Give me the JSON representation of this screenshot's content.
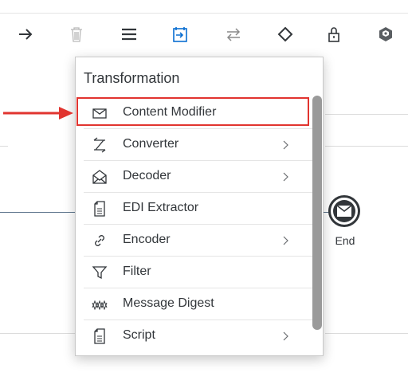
{
  "toolbar": {
    "items": [
      {
        "icon": "arrow-right-icon"
      },
      {
        "icon": "trash-icon"
      },
      {
        "icon": "menu-lines-icon"
      },
      {
        "icon": "transformation-icon"
      },
      {
        "icon": "exchange-icon"
      },
      {
        "icon": "diamond-icon"
      },
      {
        "icon": "lock-icon"
      },
      {
        "icon": "cube-icon"
      }
    ]
  },
  "canvas": {
    "end_event_label": "End"
  },
  "menu": {
    "title": "Transformation",
    "items": [
      {
        "label": "Content Modifier",
        "icon": "envelope-icon",
        "has_submenu": false,
        "highlighted": true
      },
      {
        "label": "Converter",
        "icon": "converter-icon",
        "has_submenu": true
      },
      {
        "label": "Decoder",
        "icon": "open-envelope-icon",
        "has_submenu": true
      },
      {
        "label": "EDI Extractor",
        "icon": "document-icon",
        "has_submenu": false
      },
      {
        "label": "Encoder",
        "icon": "link-icon",
        "has_submenu": true
      },
      {
        "label": "Filter",
        "icon": "filter-icon",
        "has_submenu": false
      },
      {
        "label": "Message Digest",
        "icon": "zigzag-icon",
        "has_submenu": false
      },
      {
        "label": "Script",
        "icon": "script-document-icon",
        "has_submenu": true
      }
    ]
  },
  "colors": {
    "highlight": "#e1342f",
    "accent": "#0a6ed1",
    "text": "#32363a"
  }
}
